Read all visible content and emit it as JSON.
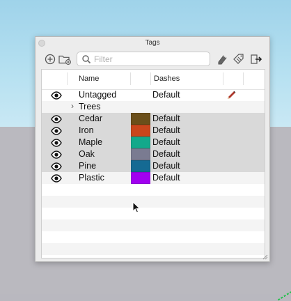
{
  "window": {
    "title": "Tags"
  },
  "toolbar": {
    "icons": [
      "add-tag-icon",
      "add-folder-icon",
      "search-icon",
      "details-icon",
      "tag-tool-icon",
      "export-icon"
    ]
  },
  "search": {
    "placeholder": "Filter",
    "value": ""
  },
  "table": {
    "columns": [
      "Name",
      "Dashes"
    ],
    "rows": [
      {
        "name": "Untagged",
        "visible": true,
        "color": null,
        "dashes": "Default",
        "active": true,
        "selected": false
      },
      {
        "name": "Trees",
        "visible": false,
        "folder": true,
        "color": null,
        "dashes": "",
        "selected": false
      },
      {
        "name": "Cedar",
        "visible": true,
        "color": "#6b4f1a",
        "dashes": "Default",
        "selected": true
      },
      {
        "name": "Iron",
        "visible": true,
        "color": "#c9461c",
        "dashes": "Default",
        "selected": true
      },
      {
        "name": "Maple",
        "visible": true,
        "color": "#13a98b",
        "dashes": "Default",
        "selected": true
      },
      {
        "name": "Oak",
        "visible": true,
        "color": "#7a7b91",
        "dashes": "Default",
        "selected": true
      },
      {
        "name": "Pine",
        "visible": true,
        "color": "#156a93",
        "dashes": "Default",
        "selected": true
      },
      {
        "name": "Plastic",
        "visible": true,
        "color": "#a100f0",
        "dashes": "Default",
        "selected": false
      }
    ]
  },
  "colors": {
    "selection": "#d9d9d9",
    "panel": "#ececec"
  }
}
